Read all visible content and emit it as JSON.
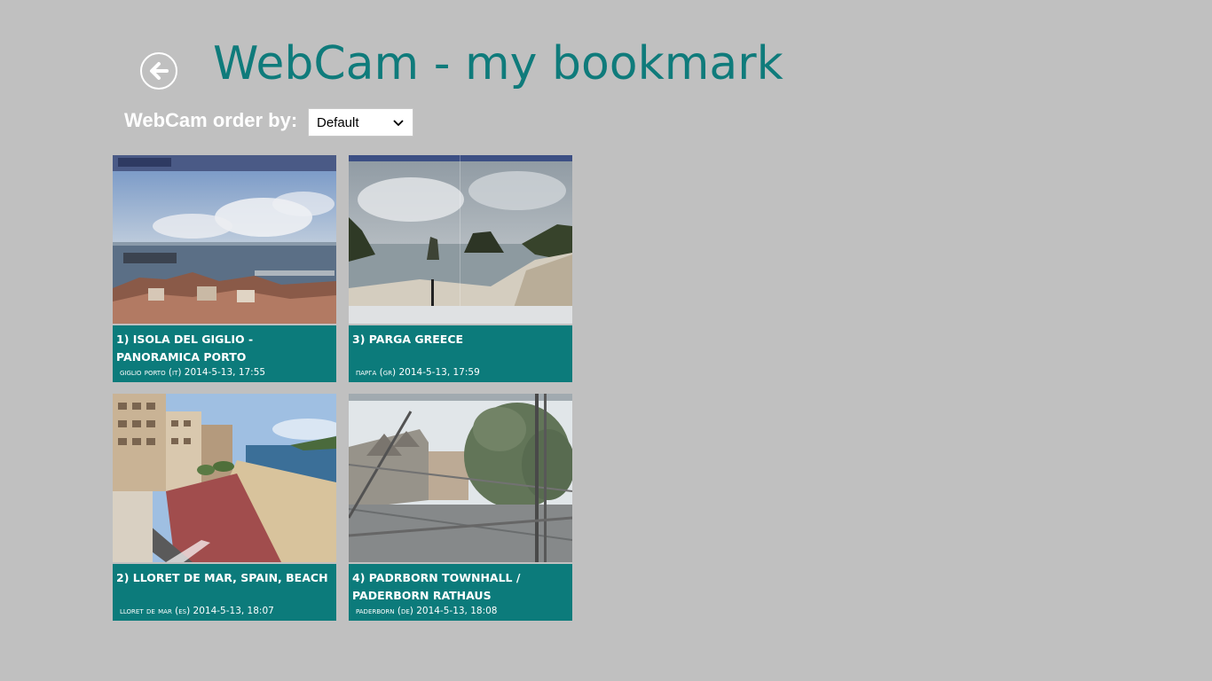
{
  "header": {
    "title": "WebCam - my bookmark",
    "back_icon": "arrow-left-circle-icon"
  },
  "order": {
    "label": "WebCam order by:",
    "selected": "Default"
  },
  "colors": {
    "background": "#c0c0c0",
    "accent": "#0f7b7b",
    "caption_bg": "#0c7b7b"
  },
  "webcams": [
    {
      "title": "1) ISOLA DEL GIGLIO - PANORAMICA PORTO",
      "subtitle": "giglio porto (it) 2014-5-13, 17:55"
    },
    {
      "title": "3) PARGA GREECE",
      "subtitle": "πарга (gr) 2014-5-13, 17:59"
    },
    {
      "title": "2) LLORET DE MAR, SPAIN, BEACH",
      "subtitle": "lloret de mar (es) 2014-5-13, 18:07"
    },
    {
      "title": "4) PADRBORN TOWNHALL / PADERBORN RATHAUS",
      "subtitle": "paderborn (de) 2014-5-13, 18:08"
    }
  ]
}
